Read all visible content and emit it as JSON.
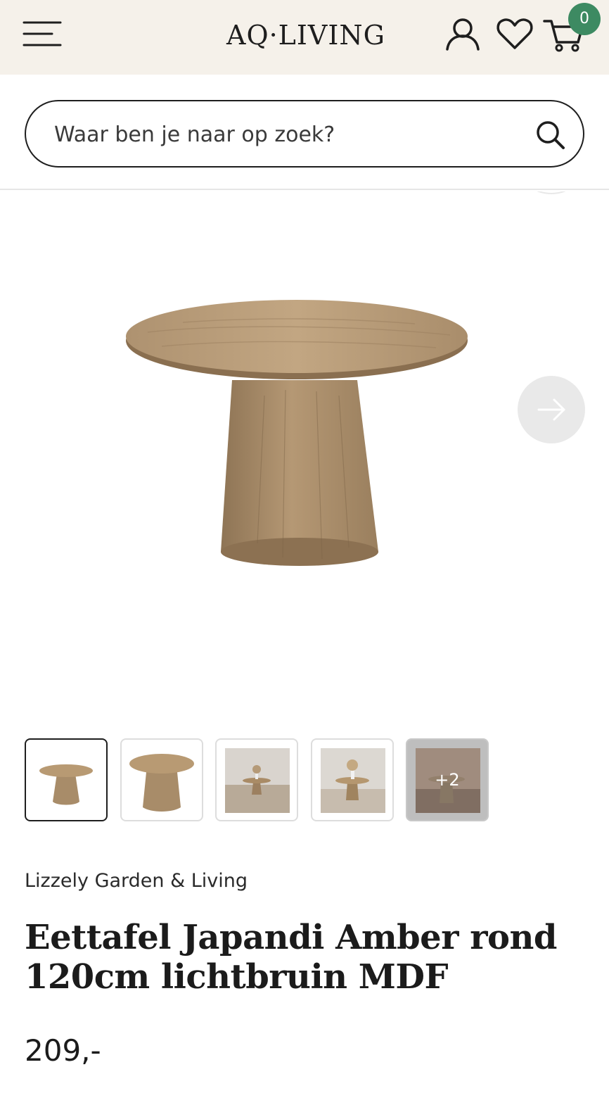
{
  "header": {
    "logo": "AQ·LIVING",
    "cart_count": "0",
    "icons": [
      "menu-icon",
      "account-icon",
      "heart-icon",
      "cart-icon"
    ]
  },
  "search": {
    "placeholder": "Waar ben je naar op zoek?",
    "icon": "search-icon"
  },
  "gallery": {
    "next_icon": "arrow-right-icon",
    "thumbnails": [
      {
        "type": "product"
      },
      {
        "type": "product"
      },
      {
        "type": "room"
      },
      {
        "type": "room"
      },
      {
        "type": "room",
        "overlay": "+2"
      }
    ]
  },
  "product": {
    "brand": "Lizzely Garden & Living",
    "title": "Eettafel Japandi Amber rond 120cm lichtbruin MDF",
    "price": "209,-"
  },
  "colors": {
    "header_bg": "#f5f1ea",
    "badge": "#3d8a62",
    "wood_light": "#b89a73",
    "wood_dark": "#7d6448"
  }
}
